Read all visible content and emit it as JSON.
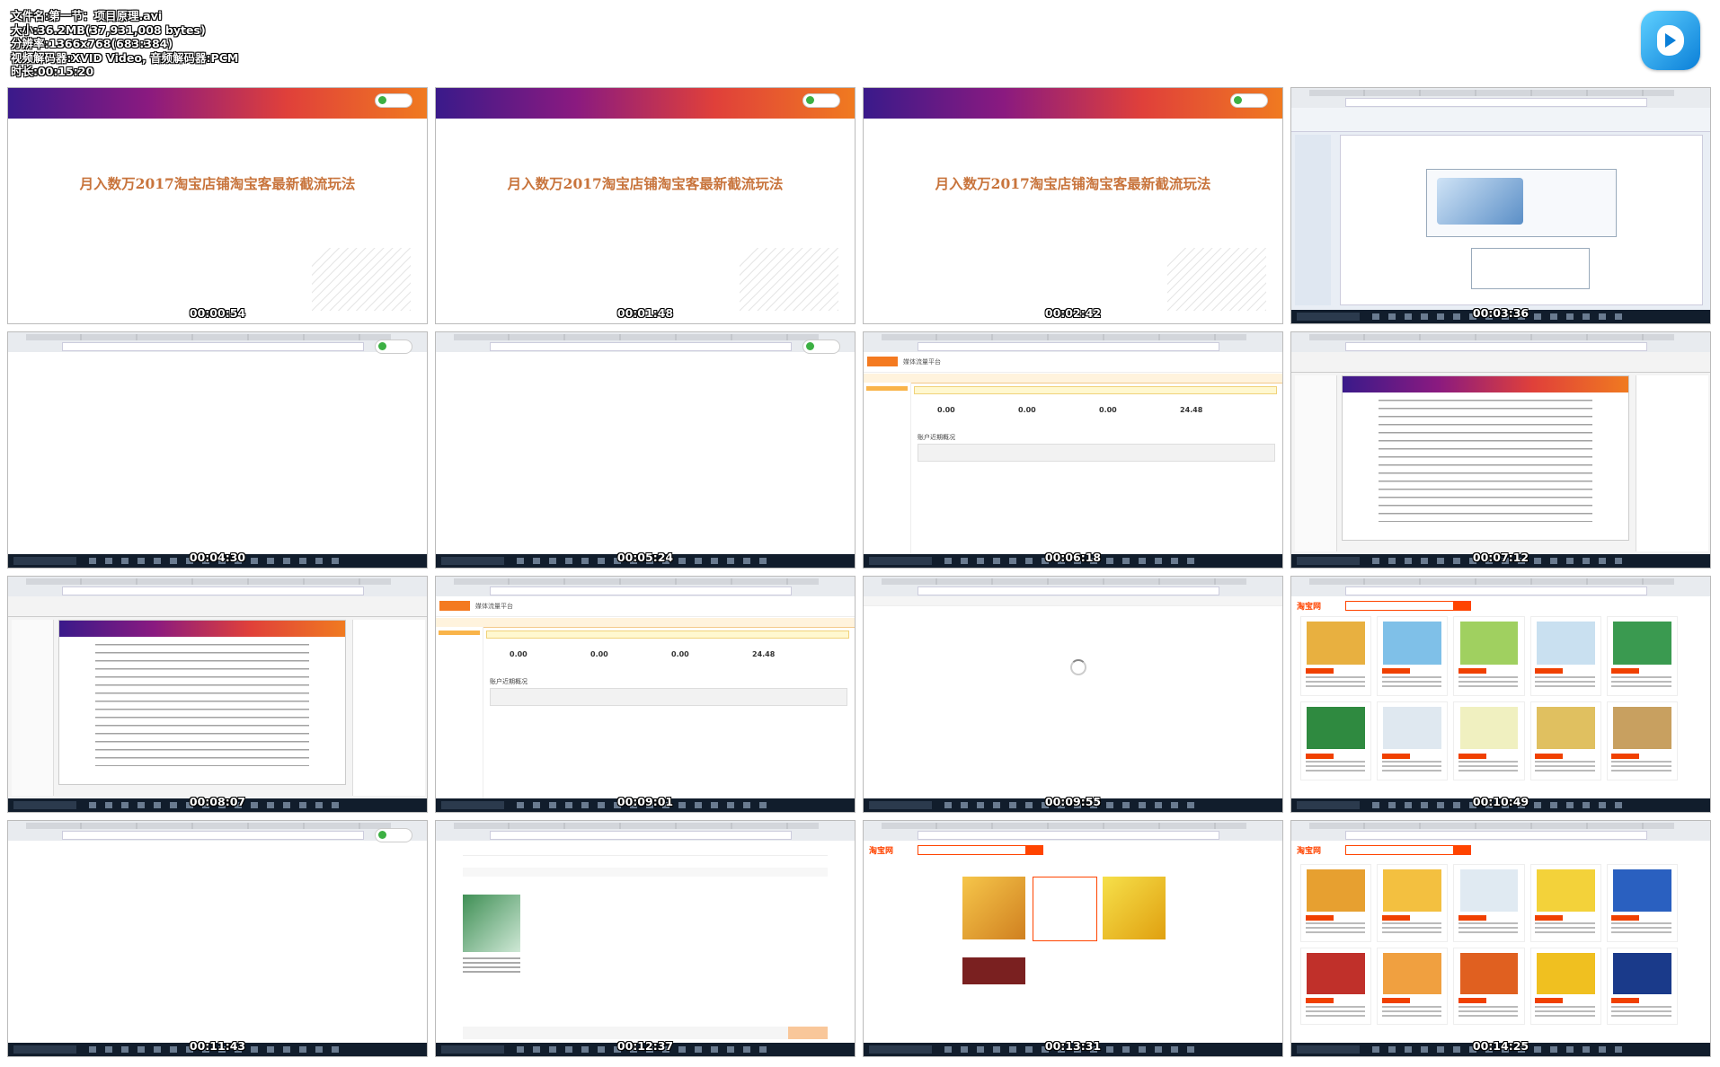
{
  "file_info": {
    "name_line": "文件名:第一节：项目原理.avi",
    "size_line": "大小:36.2MB(37,931,008 bytes)",
    "resolution_line": "分辨率:1366x768(683:384)",
    "codec_line": "视频解码器:XVID Video, 音频解码器:PCM",
    "duration_line": "时长:00:15:20"
  },
  "slide_title": "月入数万2017淘宝店铺淘宝客最新截流玩法",
  "dashboard": {
    "logo": "阿里妈妈",
    "title": "媒体流量平台",
    "section": "账户近期概况",
    "stat1": "0.00",
    "stat2": "0.00",
    "stat3": "0.00",
    "stat4": "24.48"
  },
  "taobao_logo": "淘宝网",
  "thumbnails": [
    {
      "time": "00:00:54"
    },
    {
      "time": "00:01:48"
    },
    {
      "time": "00:02:42"
    },
    {
      "time": "00:03:36"
    },
    {
      "time": "00:04:30"
    },
    {
      "time": "00:05:24"
    },
    {
      "time": "00:06:18"
    },
    {
      "time": "00:07:12"
    },
    {
      "time": "00:08:07"
    },
    {
      "time": "00:09:01"
    },
    {
      "time": "00:09:55"
    },
    {
      "time": "00:10:49"
    },
    {
      "time": "00:11:43"
    },
    {
      "time": "00:12:37"
    },
    {
      "time": "00:13:31"
    },
    {
      "time": "00:14:25"
    }
  ]
}
